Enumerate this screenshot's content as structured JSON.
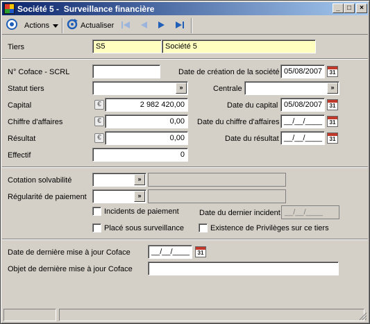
{
  "window": {
    "title": "Société 5 -  Surveillance financière",
    "controls": {
      "minimize": "_",
      "maximize": "□",
      "close": "×"
    }
  },
  "toolbar": {
    "actions_label": "Actions",
    "refresh_label": "Actualiser",
    "icons": [
      "actions-circle-icon",
      "refresh-icon",
      "first-record-icon",
      "previous-record-icon",
      "next-record-icon",
      "last-record-icon"
    ]
  },
  "tiers": {
    "label": "Tiers",
    "code": "S5",
    "name": "Société 5"
  },
  "identity": {
    "coface_label": "N° Coface - SCRL",
    "coface_value": "",
    "creation_date_label": "Date de création de la société",
    "creation_date_value": "05/08/2007",
    "statut_label": "Statut tiers",
    "statut_value": "",
    "centrale_label": "Centrale",
    "centrale_value": "",
    "capital_label": "Capital",
    "capital_value": "2 982 420,00",
    "capital_date_label": "Date du capital",
    "capital_date_value": "05/08/2007",
    "ca_label": "Chiffre d'affaires",
    "ca_value": "0,00",
    "ca_date_label": "Date du chiffre d'affaires",
    "ca_date_value": "__/__/____",
    "resultat_label": "Résultat",
    "resultat_value": "0,00",
    "resultat_date_label": "Date du résultat",
    "resultat_date_value": "__/__/____",
    "effectif_label": "Effectif",
    "effectif_value": "0",
    "currency_symbol": "€",
    "calendar_day": "31"
  },
  "solvency": {
    "cotation_label": "Cotation solvabilité",
    "cotation_value": "",
    "regularite_label": "Régularité de paiement",
    "regularite_value": "",
    "incidents_label": "Incidents de paiement",
    "last_incident_label": "Date du dernier incident",
    "last_incident_value": "__/__/____",
    "surveillance_label": "Placé sous surveillance",
    "privileges_label": "Existence de Privilèges sur ce tiers"
  },
  "coface_update": {
    "date_label": "Date de dernière mise à jour Coface",
    "date_value": "__/__/____",
    "objet_label": "Objet de dernière mise à jour Coface",
    "objet_value": ""
  },
  "colors": {
    "title_start": "#0a246a",
    "title_end": "#a6caf0",
    "nav_blue": "#1f5fb8",
    "field_yellow": "#ffffc0",
    "window_bg": "#d4d0c8"
  }
}
